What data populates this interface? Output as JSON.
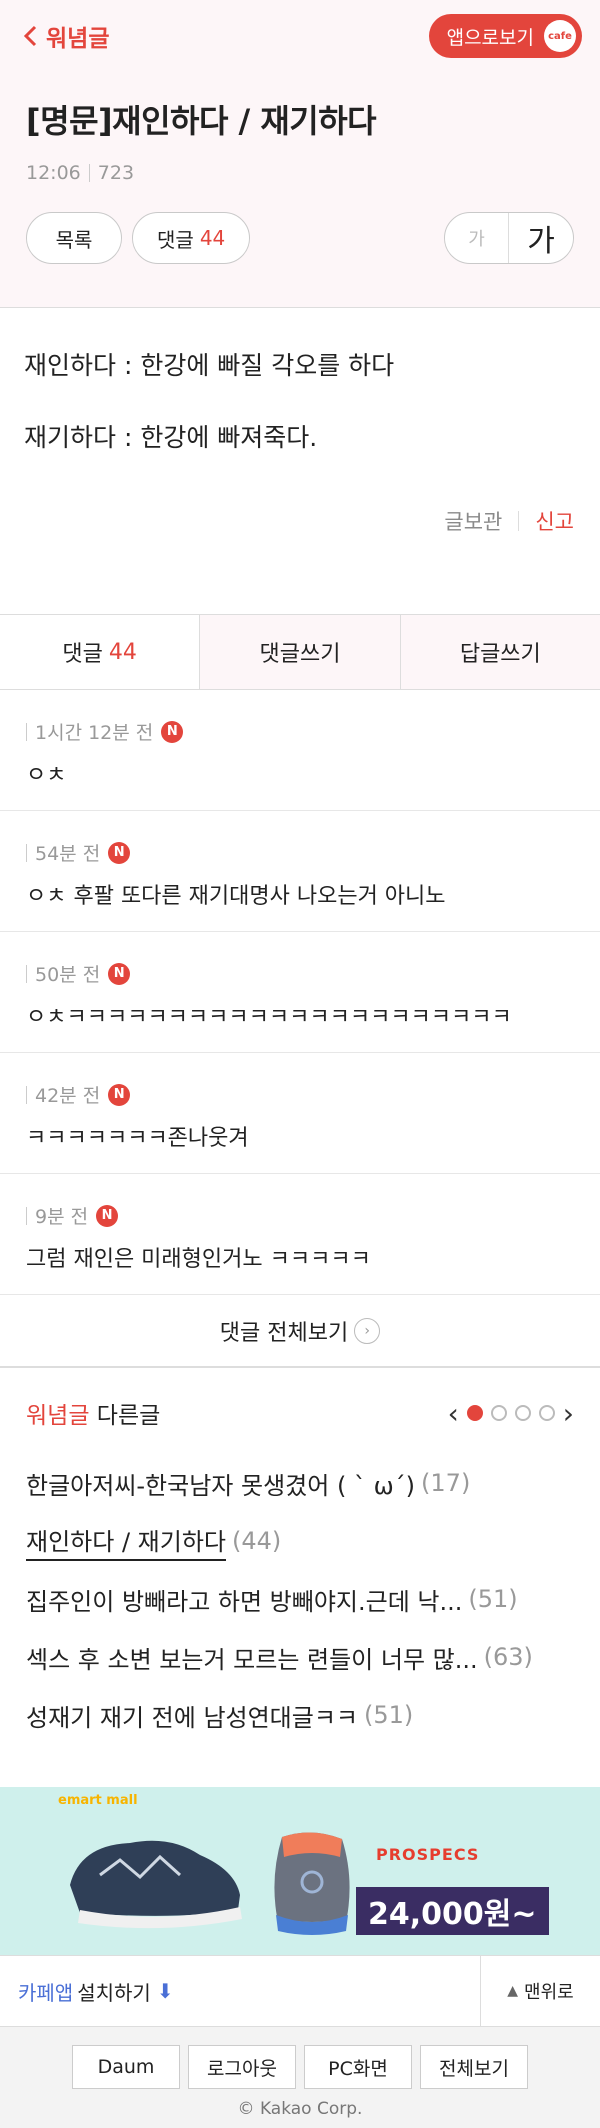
{
  "topbar": {
    "back_label": "워념글",
    "app_button": "앱으로보기",
    "cafe_badge": "cafe"
  },
  "post": {
    "title": "[명문]재인하다 / 재기하다",
    "time": "12:06",
    "views": "723",
    "list_button": "목록",
    "comment_button": "댓글",
    "comment_count": "44",
    "font_small": "가",
    "font_large": "가",
    "body": [
      "재인하다 : 한강에 빠질 각오를 하다",
      "재기하다 : 한강에 빠져죽다."
    ],
    "save_label": "글보관",
    "report_label": "신고"
  },
  "tabs": {
    "comments_label": "댓글",
    "comments_count": "44",
    "write_comment": "댓글쓰기",
    "write_reply": "답글쓰기"
  },
  "comments": [
    {
      "time": "1시간 12분 전",
      "badge": "N",
      "text": "ㅇㅊ"
    },
    {
      "time": "54분 전",
      "badge": "N",
      "text": "ㅇㅊ 후팔 또다른 재기대명사 나오는거 아니노"
    },
    {
      "time": "50분 전",
      "badge": "N",
      "text": "ㅇㅊㅋㅋㅋㅋㅋㅋㅋㅋㅋㅋㅋㅋㅋㅋㅋㅋㅋㅋㅋㅋㅋㅋ"
    },
    {
      "time": "42분 전",
      "badge": "N",
      "text": "ㅋㅋㅋㅋㅋㅋㅋ존나웃겨"
    },
    {
      "time": "9분 전",
      "badge": "N",
      "text": "그럼 재인은 미래형인거노 ㅋㅋㅋㅋㅋ"
    }
  ],
  "see_all": "댓글 전체보기",
  "others": {
    "board": "워념글",
    "label": "다른글",
    "items": [
      {
        "title": "한글아저씨-한국남자 못생겼어 ( ` ω´)",
        "count": "(17)"
      },
      {
        "title": "재인하다 / 재기하다",
        "count": "(44)"
      },
      {
        "title": "집주인이 방빼라고 하면 방빼야지.근데 낙...",
        "count": "(51)"
      },
      {
        "title": "섹스 후 소변 보는거 모르는 련들이 너무 많...",
        "count": "(63)"
      },
      {
        "title": "성재기 재기 전에 남성연대글ㅋㅋ",
        "count": "(51)"
      }
    ]
  },
  "ad": {
    "brand_a": "emart",
    "brand_b": "mall",
    "logo": "PROSPECS",
    "price": "24,000원~"
  },
  "footer": {
    "cafe_app": "카페앱",
    "install": "설치하기",
    "to_top": "맨위로",
    "buttons": [
      "Daum",
      "로그아웃",
      "PC화면",
      "전체보기"
    ],
    "copyright": "© Kakao Corp."
  },
  "colors": {
    "accent": "#e3453c",
    "header_bg": "#fdf6f8",
    "ad_bg": "#cff0ec",
    "price_bg": "#3a2d63"
  }
}
